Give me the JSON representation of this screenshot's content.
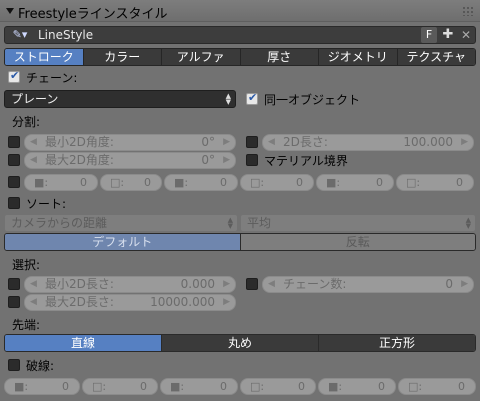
{
  "panel": {
    "title": "Freestyleラインスタイル"
  },
  "linestyle": {
    "name": "LineStyle",
    "fake_user": "F",
    "add": "✚",
    "remove": "✕"
  },
  "tabs": [
    {
      "label": "ストローク",
      "active": true
    },
    {
      "label": "カラー"
    },
    {
      "label": "アルファ"
    },
    {
      "label": "厚さ"
    },
    {
      "label": "ジオメトリ"
    },
    {
      "label": "テクスチャ"
    }
  ],
  "chain": {
    "label": "チェーン:",
    "method": "プレーン",
    "same_object": "同一オブジェクト"
  },
  "split": {
    "heading": "分割:",
    "min_angle_label": "最小2D角度:",
    "min_angle_value": "0°",
    "max_angle_label": "最大2D角度:",
    "max_angle_value": "0°",
    "length_label": "2D長さ:",
    "length_value": "100.000",
    "material_border": "マテリアル境界",
    "pattern": [
      {
        "label": "■:",
        "value": "0"
      },
      {
        "label": "□:",
        "value": "0"
      },
      {
        "label": "■:",
        "value": "0"
      },
      {
        "label": "□:",
        "value": "0"
      },
      {
        "label": "■:",
        "value": "0"
      },
      {
        "label": "□:",
        "value": "0"
      }
    ]
  },
  "sort": {
    "label": "ソート:",
    "key": "カメラからの距離",
    "integration": "平均",
    "order_default": "デフォルト",
    "order_reverse": "反転"
  },
  "selection": {
    "heading": "選択:",
    "min_length_label": "最小2D長さ:",
    "min_length_value": "0.000",
    "max_length_label": "最大2D長さ:",
    "max_length_value": "10000.000",
    "chain_count_label": "チェーン数:",
    "chain_count_value": "0"
  },
  "caps": {
    "heading": "先端:",
    "options": [
      {
        "label": "直線",
        "active": true
      },
      {
        "label": "丸め"
      },
      {
        "label": "正方形"
      }
    ]
  },
  "dashed": {
    "label": "破線:",
    "pattern": [
      {
        "label": "■:",
        "value": "0"
      },
      {
        "label": "□:",
        "value": "0"
      },
      {
        "label": "■:",
        "value": "0"
      },
      {
        "label": "□:",
        "value": "0"
      },
      {
        "label": "■:",
        "value": "0"
      },
      {
        "label": "□:",
        "value": "0"
      }
    ]
  }
}
